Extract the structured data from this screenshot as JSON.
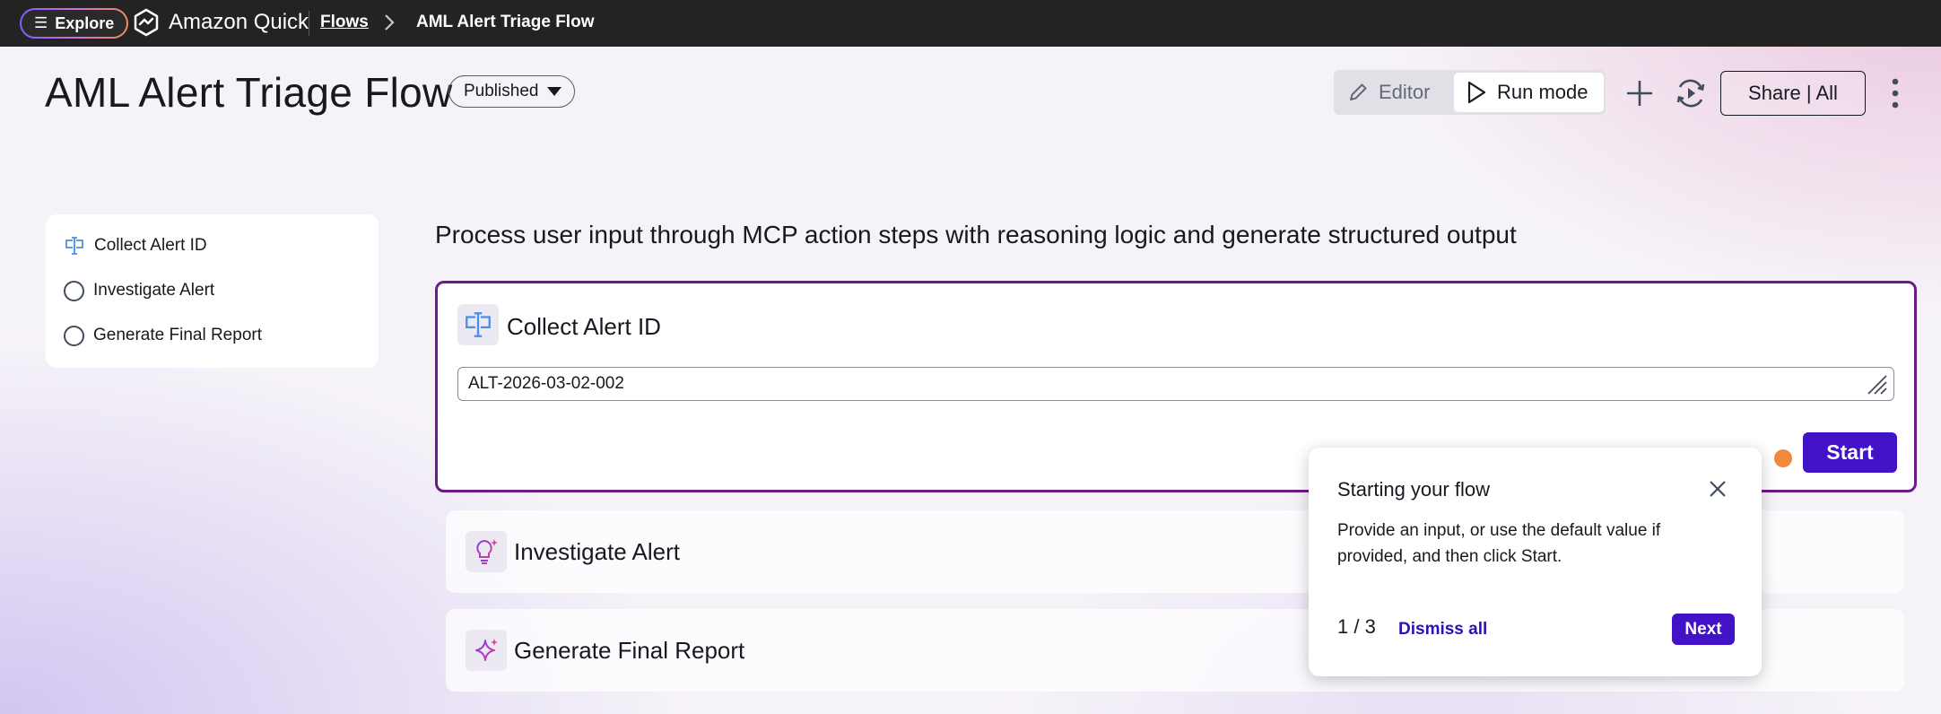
{
  "topbar": {
    "explore_label": "Explore",
    "app_name": "Amazon Quick",
    "breadcrumb": {
      "link": "Flows",
      "current": "AML Alert Triage Flow"
    }
  },
  "header": {
    "title": "AML Alert Triage Flow",
    "status": "Published",
    "mode_editor": "Editor",
    "mode_run": "Run mode",
    "share_label": "Share | All"
  },
  "sidebar": {
    "items": [
      {
        "label": "Collect Alert ID",
        "icon": "text-input-icon",
        "state": "current"
      },
      {
        "label": "Investigate Alert",
        "icon": "radio-empty",
        "state": "pending"
      },
      {
        "label": "Generate Final Report",
        "icon": "radio-empty",
        "state": "pending"
      }
    ]
  },
  "main": {
    "subtitle": "Process user input through MCP action steps with reasoning logic and generate structured output",
    "steps": [
      {
        "title": "Collect Alert ID",
        "icon": "text-input-icon",
        "input_value": "ALT-2026-03-02-002",
        "button": "Start"
      },
      {
        "title": "Investigate Alert",
        "icon": "lightbulb-sparkle-icon"
      },
      {
        "title": "Generate Final Report",
        "icon": "sparkle-icon"
      }
    ]
  },
  "popover": {
    "title": "Starting your flow",
    "body": "Provide an input, or use the default value if provided, and then click Start.",
    "step": "1 / 3",
    "dismiss": "Dismiss all",
    "next": "Next"
  },
  "colors": {
    "accent": "#4112c6",
    "active_border": "#6a1b8a",
    "indicator_dot": "#f0883e",
    "topbar": "#232323"
  }
}
